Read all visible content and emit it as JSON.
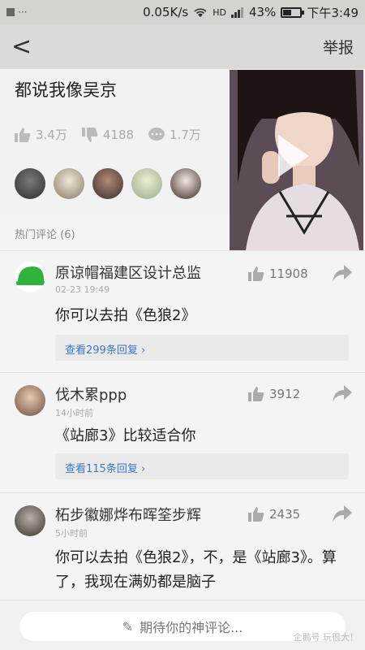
{
  "status_bar": {
    "speed": "0.05K/s",
    "network": "HD",
    "battery": "43%",
    "time": "下午3:49"
  },
  "nav": {
    "back_glyph": "<",
    "report_label": "举报"
  },
  "article": {
    "title": "都说我像吴京",
    "likes": "3.4万",
    "dislikes": "4188",
    "comments": "1.7万"
  },
  "hot_comments_label": "热门评论 (6)",
  "comments": [
    {
      "name": "原谅帽福建区设计总监",
      "time": "02-23 19:49",
      "likes": "11908",
      "text": "你可以去拍《色狼2》",
      "replies": "查看299条回复 ›"
    },
    {
      "name": "伐木累ppp",
      "time": "14小时前",
      "likes": "3912",
      "text": "《站廊3》比较适合你",
      "replies": "查看115条回复 ›"
    },
    {
      "name": "柘步徽娜烨布晖筌步辉",
      "time": "5小时前",
      "likes": "2435",
      "text": "你可以去拍《色狼2》，不，是《站廊3》。算了，我现在满奶都是脑子",
      "replies": ""
    }
  ],
  "bottom": {
    "input_placeholder": "期待你的神评论...",
    "watermark": "企鹅号 玩很大！"
  },
  "colors": {
    "link": "#3b78c7",
    "status_bar": "#d6d3cf",
    "nav_bar": "#dcdad6"
  }
}
